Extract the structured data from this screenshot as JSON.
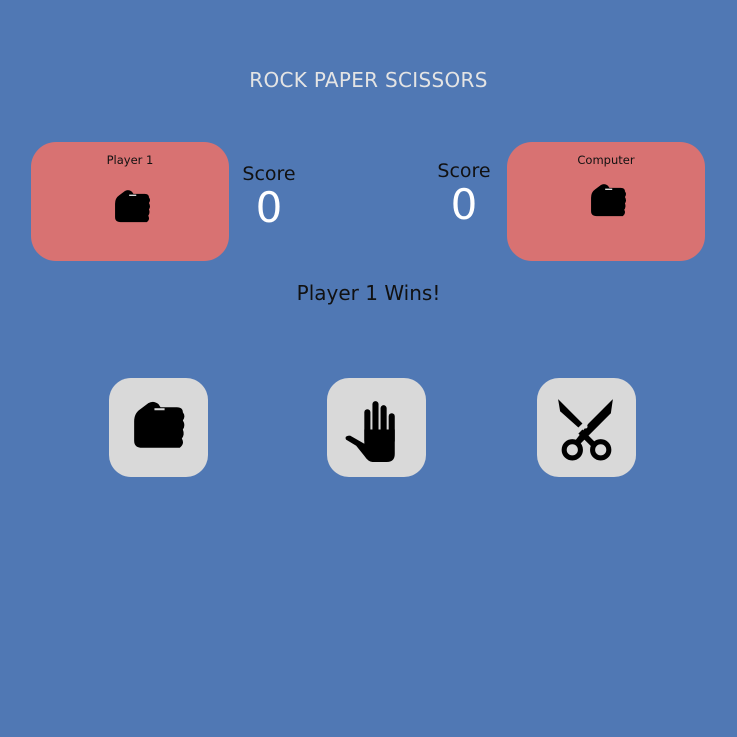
{
  "title": "ROCK PAPER SCISSORS",
  "player": {
    "name": "Player 1",
    "choice_icon": "rock-icon",
    "score_label": "Score",
    "score": "0"
  },
  "computer": {
    "name": "Computer",
    "choice_icon": "rock-icon",
    "score_label": "Score",
    "score": "0"
  },
  "result": "Player 1 Wins!",
  "choices": [
    {
      "name": "rock",
      "icon": "rock-icon"
    },
    {
      "name": "paper",
      "icon": "paper-icon"
    },
    {
      "name": "scissors",
      "icon": "scissors-icon"
    }
  ],
  "colors": {
    "background": "#5078B4",
    "card": "#D87272",
    "button": "#D9D9D9"
  }
}
